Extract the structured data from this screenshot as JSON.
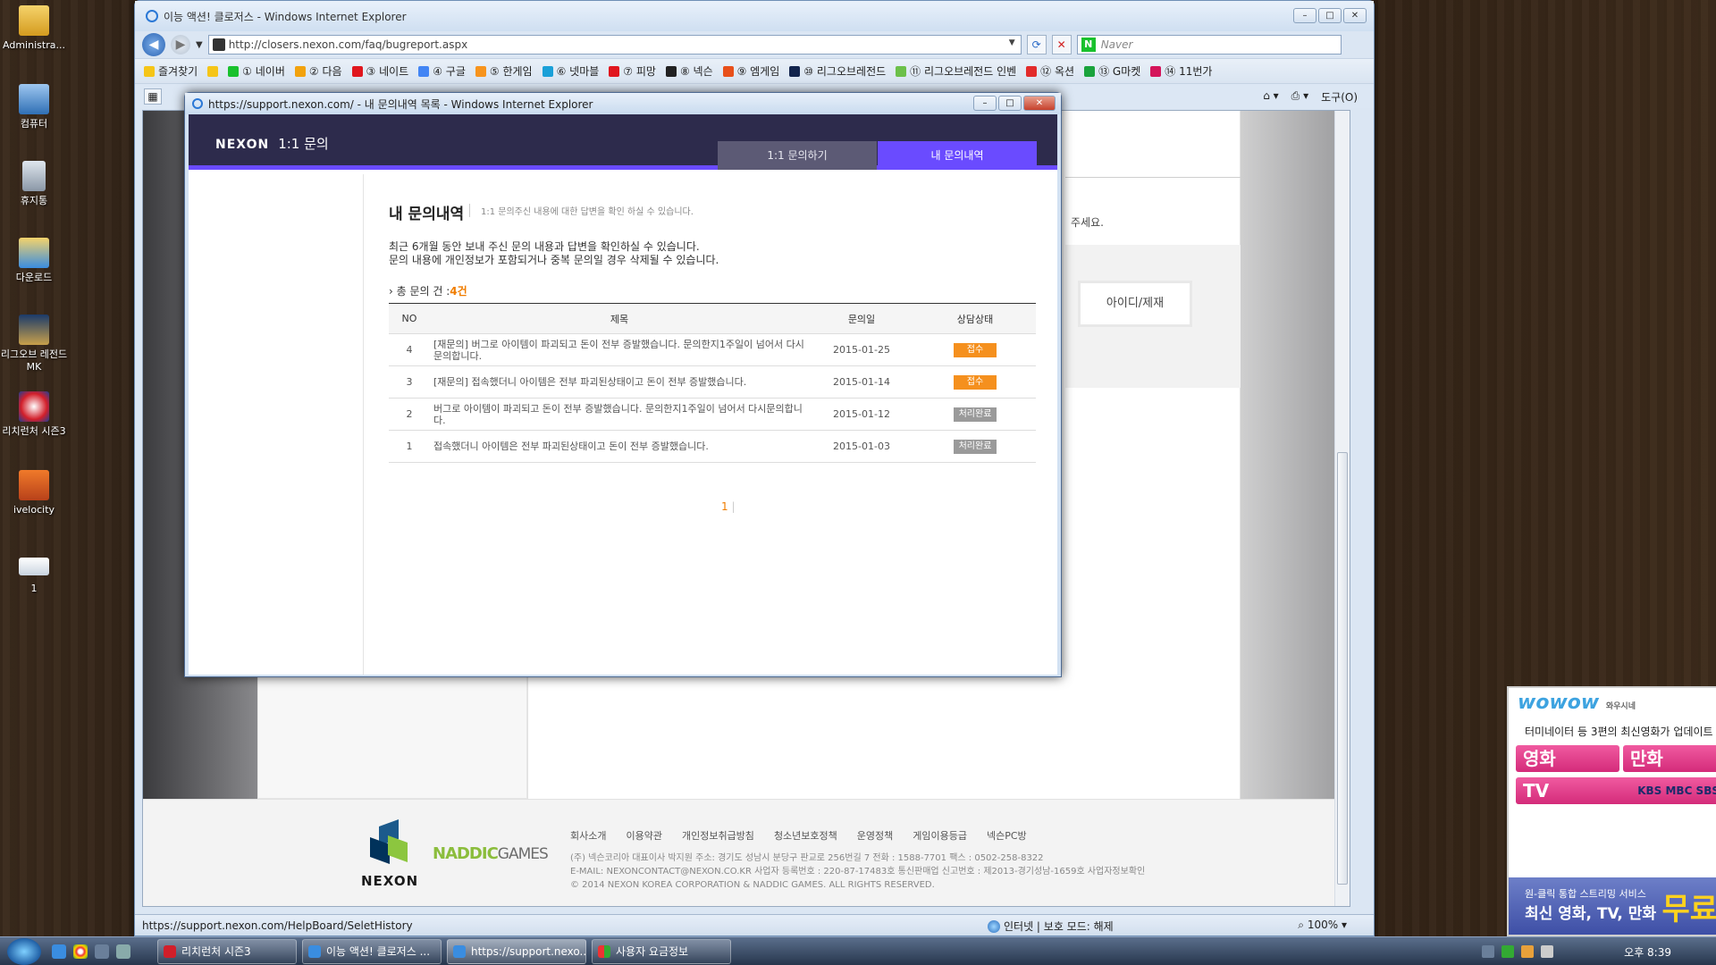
{
  "desktop": {
    "icons": [
      {
        "label": "Administra..."
      },
      {
        "label": "컴퓨터"
      },
      {
        "label": "휴지통"
      },
      {
        "label": "다운로드"
      },
      {
        "label": "리그오브 레전드 MK"
      },
      {
        "label": "리치런처 시즌3"
      },
      {
        "label": "ivelocity"
      },
      {
        "label": "1"
      }
    ]
  },
  "main_window": {
    "title": "이능 액션! 클로저스 - Windows Internet Explorer",
    "url": "http://closers.nexon.com/faq/bugreport.aspx",
    "search_placeholder": "Naver",
    "favorites_label": "즐겨찾기",
    "favorites": [
      "① 네이버",
      "② 다음",
      "③ 네이트",
      "④ 구글",
      "⑤ 한게임",
      "⑥ 넷마블",
      "⑦ 피망",
      "⑧ 넥슨",
      "⑨ 엠게임",
      "⑩ 리그오브레전드",
      "⑪ 리그오브레전드 인벤",
      "⑫ 옥션",
      "⑬ G마켓",
      "⑭ 11번가"
    ],
    "tools_label": "도구(O)",
    "page": {
      "right_text": "주세요.",
      "right_button": "아이디/제재"
    },
    "footer": {
      "logo_text": "NEXON",
      "naddic": "NADDIC",
      "games": "GAMES",
      "links": [
        "회사소개",
        "이용약관",
        "개인정보취급방침",
        "청소년보호정책",
        "운영정책",
        "게임이용등급",
        "넥슨PC방"
      ],
      "info1": "(주) 넥슨코리아 대표이사 박지원  주소: 경기도 성남시 분당구 판교로 256번길 7 전화 : 1588-7701 팩스 : 0502-258-8322",
      "info2": "E-MAIL: NEXONCONTACT@NEXON.CO.KR 사업자 등록번호 : 220-87-17483호  통신판매업 신고번호 : 제2013-경기성남-1659호  사업자정보확인",
      "info3": "© 2014 NEXON KOREA CORPORATION & NADDIC GAMES. ALL RIGHTS RESERVED."
    },
    "status_url": "https://support.nexon.com/HelpBoard/SeletHistory",
    "status_zone": "인터넷 | 보호 모드: 해제",
    "zoom": "100%"
  },
  "popup": {
    "title": "https://support.nexon.com/ - 내 문의내역 목록 - Windows Internet Explorer",
    "brand": "NEXON",
    "brand_sub": "1:1 문의",
    "tab_inquire": "1:1 문의하기",
    "tab_history": "내 문의내역",
    "heading": "내 문의내역",
    "heading_sub": "1:1 문의주신 내용에 대한 답변을 확인 하실 수 있습니다.",
    "desc1": "최근 6개월 동안 보내 주신 문의 내용과 답변을 확인하실 수 있습니다.",
    "desc2": "문의 내용에 개인정보가 포함되거나 중복 문의일 경우 삭제될 수 있습니다.",
    "total_label": "› 총 문의 건 :",
    "total_count": "4건",
    "columns": {
      "no": "NO",
      "title": "제목",
      "date": "문의일",
      "status": "상담상태"
    },
    "rows": [
      {
        "no": "4",
        "title": "[재문의] 버그로 아이템이 파괴되고 돈이 전부 증발했습니다. 문의한지1주일이 넘어서 다시문의합니다.",
        "date": "2015-01-25",
        "status": "접수",
        "color": "#f5901e"
      },
      {
        "no": "3",
        "title": "[재문의] 접속했더니 아이템은 전부 파괴된상태이고 돈이 전부 증발했습니다.",
        "date": "2015-01-14",
        "status": "접수",
        "color": "#f5901e"
      },
      {
        "no": "2",
        "title": "버그로 아이템이 파괴되고 돈이 전부 증발했습니다. 문의한지1주일이 넘어서 다시문의합니다.",
        "date": "2015-01-12",
        "status": "처리완료",
        "color": "#9a9a9a"
      },
      {
        "no": "1",
        "title": "접속했더니 아이템은 전부 파괴된상태이고 돈이 전부 증발했습니다.",
        "date": "2015-01-03",
        "status": "처리완료",
        "color": "#9a9a9a"
      }
    ],
    "page": "1"
  },
  "ad": {
    "logo": "wowow",
    "logo_sub": "와우시네",
    "promo": "터미네이터 등 3편의 최신영화가 업데이트",
    "cat1": "영화",
    "cat2": "만화",
    "cat3": "TV",
    "channels": "KBS MBC SBS",
    "bottom1": "원-클릭 통합 스트리밍 서비스",
    "bottom2": "최신 영화, TV, 만화",
    "bottom3": "무료"
  },
  "taskbar": {
    "buttons": [
      "리치런처 시즌3",
      "이능 액션! 클로저스 ...",
      "https://support.nexo...",
      "사용자 요금정보"
    ],
    "clock": "오후 8:39"
  }
}
